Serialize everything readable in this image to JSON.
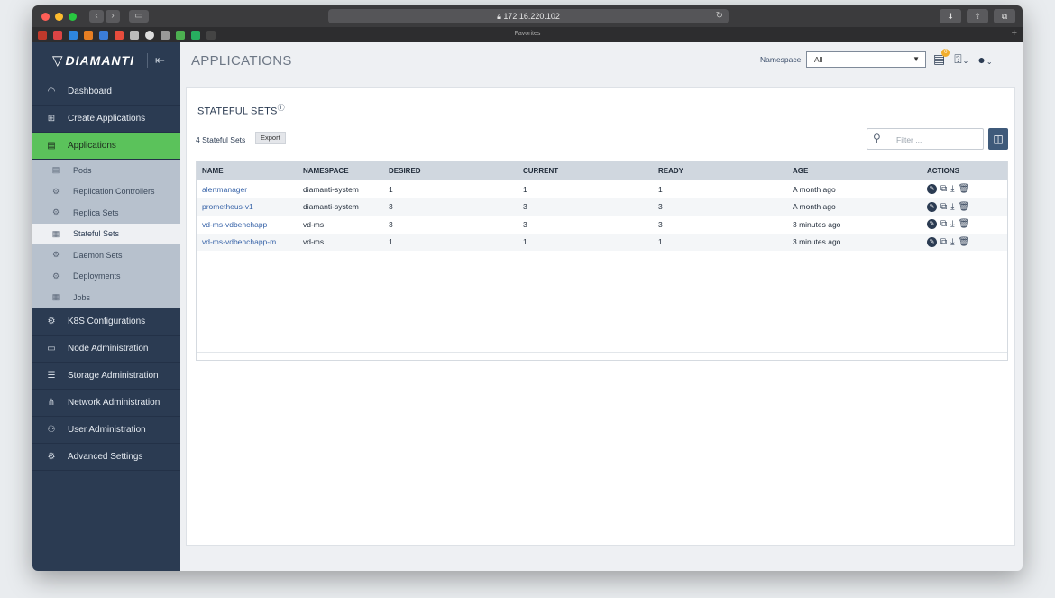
{
  "browser": {
    "url": "172.16.220.102",
    "favorites_label": "Favorites"
  },
  "brand": {
    "name": "DIAMANTI"
  },
  "sidebar": {
    "items": [
      {
        "label": "Dashboard",
        "icon": "dashboard-icon"
      },
      {
        "label": "Create Applications",
        "icon": "plus-square-icon"
      },
      {
        "label": "Applications",
        "icon": "applications-icon",
        "active": true
      }
    ],
    "subitems": [
      {
        "label": "Pods",
        "icon": "pods-icon"
      },
      {
        "label": "Replication Controllers",
        "icon": "replication-controllers-icon"
      },
      {
        "label": "Replica Sets",
        "icon": "replica-sets-icon"
      },
      {
        "label": "Stateful Sets",
        "icon": "stateful-sets-icon",
        "active": true
      },
      {
        "label": "Daemon Sets",
        "icon": "daemon-sets-icon"
      },
      {
        "label": "Deployments",
        "icon": "deployments-icon"
      },
      {
        "label": "Jobs",
        "icon": "jobs-icon"
      }
    ],
    "items2": [
      {
        "label": "K8S Configurations",
        "icon": "k8s-config-icon"
      },
      {
        "label": "Node Administration",
        "icon": "node-icon"
      },
      {
        "label": "Storage Administration",
        "icon": "storage-icon"
      },
      {
        "label": "Network Administration",
        "icon": "network-icon"
      },
      {
        "label": "User Administration",
        "icon": "users-icon"
      },
      {
        "label": "Advanced Settings",
        "icon": "advanced-settings-icon"
      }
    ]
  },
  "header": {
    "title": "APPLICATIONS",
    "namespace_label": "Namespace",
    "namespace_value": "All",
    "notification_count": "0"
  },
  "panel": {
    "title": "STATEFUL SETS",
    "count_label": "4 Stateful Sets",
    "export_label": "Export",
    "filter_placeholder": "Filter ..."
  },
  "table": {
    "columns": [
      "NAME",
      "NAMESPACE",
      "DESIRED",
      "CURRENT",
      "READY",
      "AGE",
      "ACTIONS"
    ],
    "rows": [
      {
        "name": "alertmanager",
        "namespace": "diamanti-system",
        "desired": "1",
        "current": "1",
        "ready": "1",
        "age": "A month ago"
      },
      {
        "name": "prometheus-v1",
        "namespace": "diamanti-system",
        "desired": "3",
        "current": "3",
        "ready": "3",
        "age": "A month ago"
      },
      {
        "name": "vd-ms-vdbenchapp",
        "namespace": "vd-ms",
        "desired": "3",
        "current": "3",
        "ready": "3",
        "age": "3 minutes ago"
      },
      {
        "name": "vd-ms-vdbenchapp-m...",
        "namespace": "vd-ms",
        "desired": "1",
        "current": "1",
        "ready": "1",
        "age": "3 minutes ago"
      }
    ]
  }
}
